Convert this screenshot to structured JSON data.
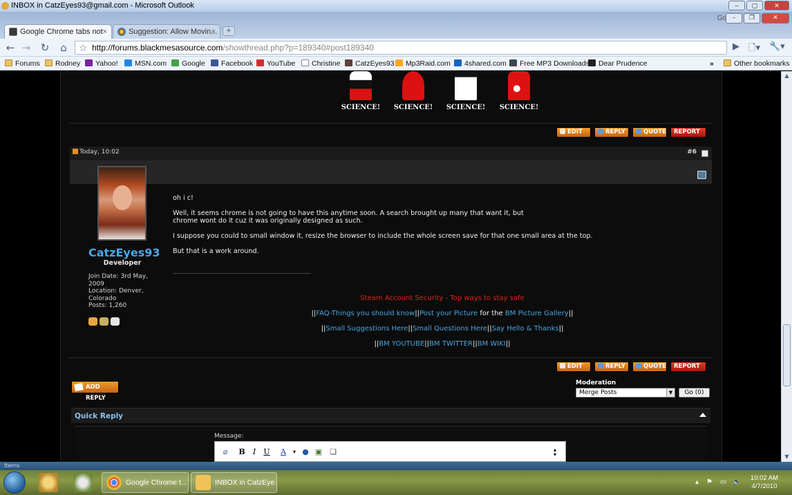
{
  "outlook": {
    "title": "INBOX in CatzEyes93@gmail.com - Microsoft Outlook"
  },
  "chrome": {
    "tabs": [
      {
        "label": "Google Chrome tabs not ...",
        "active": true
      },
      {
        "label": "Suggestion: Allow Movin...",
        "active": false
      }
    ],
    "google_label": "Google",
    "url_host": "http://forums.blackmesasource.com",
    "url_path": "/showthread.php?p=189340#post189340",
    "bookmarks": [
      {
        "label": "Forums",
        "icon": "folder-icon"
      },
      {
        "label": "Rodney",
        "icon": "folder-icon"
      },
      {
        "label": "Yahoo!",
        "icon": "yahoo-icon"
      },
      {
        "label": "MSN.com",
        "icon": "msn-icon"
      },
      {
        "label": "Google",
        "icon": "google-icon"
      },
      {
        "label": "Facebook",
        "icon": "facebook-icon"
      },
      {
        "label": "YouTube",
        "icon": "youtube-icon"
      },
      {
        "label": "Christine",
        "icon": "page-icon"
      },
      {
        "label": "CatzEyes93",
        "icon": "site-icon"
      },
      {
        "label": "Mp3Raid.com",
        "icon": "music-icon"
      },
      {
        "label": "4shared.com",
        "icon": "4shared-icon"
      },
      {
        "label": "Free MP3 Downloads",
        "icon": "mp3-icon"
      },
      {
        "label": "Dear Prudence",
        "icon": "s-icon"
      }
    ],
    "bookmarks_overflow": "»",
    "other_bookmarks": "Other bookmarks"
  },
  "signature_badges": [
    "SCIENCE!",
    "SCIENCE!",
    "SCIENCE!",
    "SCIENCE!"
  ],
  "post_actions": {
    "edit": "EDIT",
    "reply": "REPLY",
    "quote": "QUOTE",
    "report": "REPORT"
  },
  "post": {
    "date": "Today, 10:02",
    "number": "#6",
    "username": "CatzEyes93",
    "user_title": "Developer",
    "join_date": "Join Date: 3rd May,\n2009",
    "location": "Location: Denver,\nColorado",
    "posts": "Posts: 1,260",
    "message": [
      "oh i c!",
      "Well, it seems chrome is not going to have this anytime soon. A search brought up many that want it, but\nchrome wont do it cuz it was originally designed as such.",
      "I suppose you could to small window it, resize the browser to include the whole screen save for that one small area at the top.",
      "But that is a work around."
    ],
    "signature": {
      "security_link": "Steam Account Security - Top ways to stay safe",
      "line2": {
        "pre": "||",
        "faq": "FAQ-Things you should know",
        "sep1": "||",
        "picture": "Post your Picture",
        "mid": " for the ",
        "gallery": "BM Picture Gallery",
        "post": "||"
      },
      "line3": {
        "pre": "||",
        "suggestions": "Small Suggestions Here",
        "sep1": "||",
        "questions": "Small Questions Here",
        "sep2": "||",
        "hello": "Say Hello & Thanks",
        "post": "||"
      },
      "line4": {
        "pre": "||",
        "youtube": "BM YOUTUBE",
        "sep1": "||",
        "twitter": "BM TWITTER",
        "sep2": "||",
        "wiki": "BM WIKI",
        "post": "||"
      }
    }
  },
  "add_reply": "ADD REPLY",
  "moderation": {
    "label": "Moderation",
    "selected": "Merge Posts",
    "go": "Go (0)"
  },
  "quick_reply": {
    "title": "Quick Reply",
    "message_label": "Message:"
  },
  "editor_buttons": [
    "B",
    "I",
    "U",
    "A"
  ],
  "status_stub": "Items",
  "taskbar": {
    "tasks": [
      {
        "label": "Google Chrome t...",
        "icon": "chrome-icon"
      },
      {
        "label": "INBOX in CatzEye...",
        "icon": "outlook-icon"
      }
    ],
    "time": "10:02 AM",
    "date": "4/7/2010"
  },
  "colors": {
    "accent_link": "#4aa3e0",
    "username": "#49a6e6",
    "security_red": "#e0251b",
    "button_orange": "#f19a2b",
    "report_red": "#e33a2a"
  }
}
